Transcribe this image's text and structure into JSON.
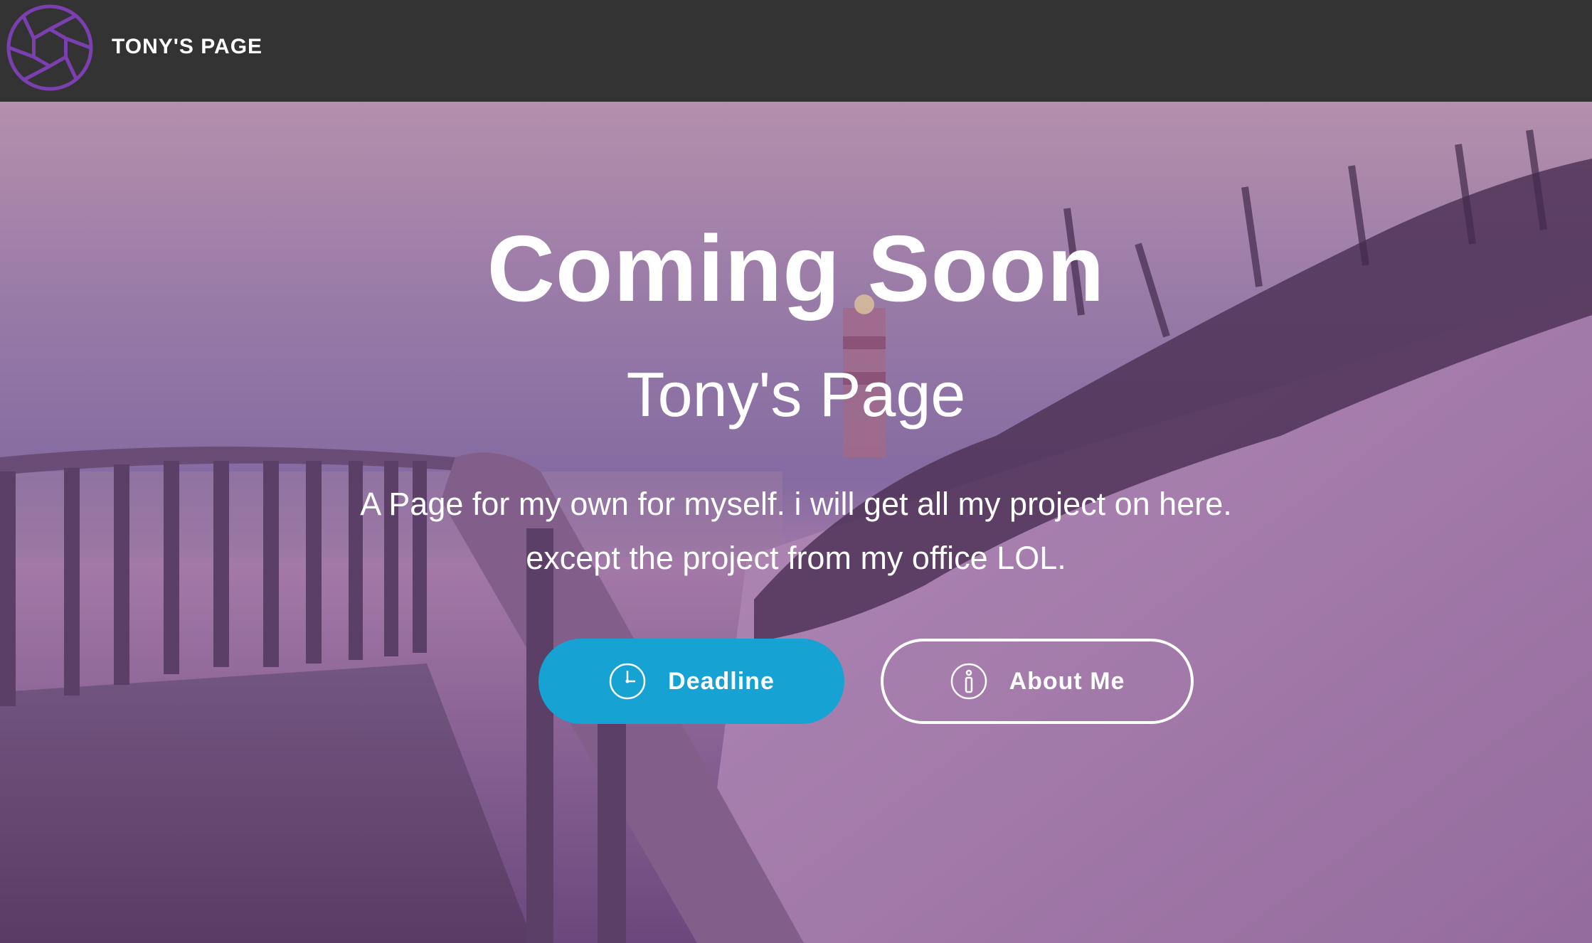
{
  "navbar": {
    "brand": "TONY'S PAGE",
    "logo_icon": "camera-aperture-icon",
    "logo_color": "#7b3fb0",
    "background": "#333333"
  },
  "hero": {
    "title": "Coming Soon",
    "subtitle": "Tony's Page",
    "description_line1": "A Page for my own for myself. i will get all my project on here.",
    "description_line2": "except the project from my office LOL.",
    "buttons": {
      "deadline": {
        "label": "Deadline",
        "icon": "clock-icon",
        "color": "#17a2d4"
      },
      "about": {
        "label": "About Me",
        "icon": "info-icon"
      }
    }
  }
}
